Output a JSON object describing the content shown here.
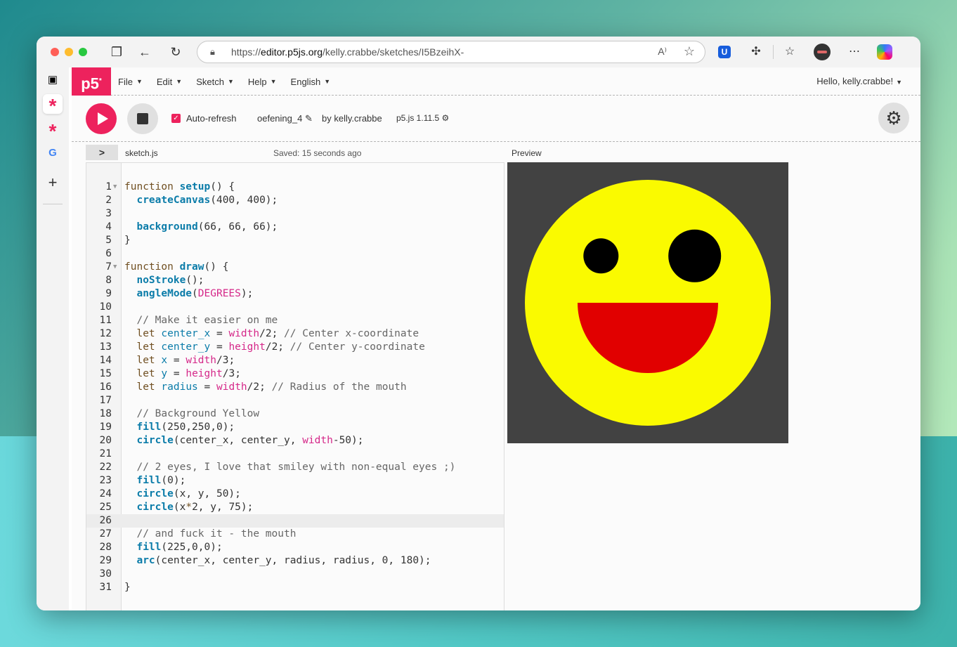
{
  "browser": {
    "url_prefix": "https://",
    "url_domain": "editor.p5js.org",
    "url_path": "/kelly.crabbe/sketches/I5BzeihX-",
    "read_aloud_label": "A⁾"
  },
  "p5": {
    "logo": "p5",
    "menu": [
      {
        "label": "File"
      },
      {
        "label": "Edit"
      },
      {
        "label": "Sketch"
      },
      {
        "label": "Help"
      },
      {
        "label": "English"
      }
    ],
    "greeting": "Hello, kelly.crabbe!",
    "auto_refresh_label": "Auto-refresh",
    "sketch_name": "oefening_4",
    "by_label": "by kelly.crabbe",
    "version": "p5.js 1.11.5",
    "file_name": "sketch.js",
    "saved_status": "Saved: 15 seconds ago",
    "preview_label": "Preview"
  },
  "colors": {
    "accent": "#ed225d",
    "canvas_bg": "#424242",
    "face": "#fafa00",
    "eyes": "#000000",
    "mouth": "#e10000"
  },
  "code_lines": [
    {
      "n": "1",
      "fold": true,
      "html": "<span class='kw'>function</span> <span class='fn'>setup</span>() {"
    },
    {
      "n": "2",
      "html": "  <span class='fn'>createCanvas</span>(400, 400);"
    },
    {
      "n": "3",
      "html": ""
    },
    {
      "n": "4",
      "html": "  <span class='fn'>background</span>(66, 66, 66);"
    },
    {
      "n": "5",
      "html": "}"
    },
    {
      "n": "6",
      "html": ""
    },
    {
      "n": "7",
      "fold": true,
      "html": "<span class='kw'>function</span> <span class='fn'>draw</span>() {"
    },
    {
      "n": "8",
      "html": "  <span class='fn'>noStroke</span>();"
    },
    {
      "n": "9",
      "html": "  <span class='fn'>angleMode</span>(<span class='pr'>DEGREES</span>);"
    },
    {
      "n": "10",
      "html": ""
    },
    {
      "n": "11",
      "html": "  <span class='cm'>// Make it easier on me</span>"
    },
    {
      "n": "12",
      "html": "  <span class='kw'>let</span> <span class='var'>center_x</span> = <span class='pr'>width</span>/2; <span class='cm'>// Center x-coordinate</span>"
    },
    {
      "n": "13",
      "html": "  <span class='kw'>let</span> <span class='var'>center_y</span> = <span class='pr'>height</span>/2; <span class='cm'>// Center y-coordinate</span>"
    },
    {
      "n": "14",
      "html": "  <span class='kw'>let</span> <span class='var'>x</span> = <span class='pr'>width</span>/3;"
    },
    {
      "n": "15",
      "html": "  <span class='kw'>let</span> <span class='var'>y</span> = <span class='pr'>height</span>/3;"
    },
    {
      "n": "16",
      "html": "  <span class='kw'>let</span> <span class='var'>radius</span> = <span class='pr'>width</span>/2; <span class='cm'>// Radius of the mouth</span>"
    },
    {
      "n": "17",
      "html": ""
    },
    {
      "n": "18",
      "html": "  <span class='cm'>// Background Yellow</span>"
    },
    {
      "n": "19",
      "html": "  <span class='fn'>fill</span>(250,250,0);"
    },
    {
      "n": "20",
      "html": "  <span class='fn'>circle</span>(center_x, center_y, <span class='pr'>width</span>-50);"
    },
    {
      "n": "21",
      "html": ""
    },
    {
      "n": "22",
      "html": "  <span class='cm'>// 2 eyes, I love that smiley with non-equal eyes ;)</span>"
    },
    {
      "n": "23",
      "html": "  <span class='fn'>fill</span>(0);"
    },
    {
      "n": "24",
      "html": "  <span class='fn'>circle</span>(x, y, 50);"
    },
    {
      "n": "25",
      "html": "  <span class='fn'>circle</span>(x<span class='kw'>*</span>2, y, 75);"
    },
    {
      "n": "26",
      "active": true,
      "html": ""
    },
    {
      "n": "27",
      "html": "  <span class='cm'>// and fuck it - the mouth</span>"
    },
    {
      "n": "28",
      "html": "  <span class='fn'>fill</span>(225,0,0);"
    },
    {
      "n": "29",
      "html": "  <span class='fn'>arc</span>(center_x, center_y, radius, radius, 0, 180);"
    },
    {
      "n": "30",
      "html": ""
    },
    {
      "n": "31",
      "html": "}"
    }
  ]
}
